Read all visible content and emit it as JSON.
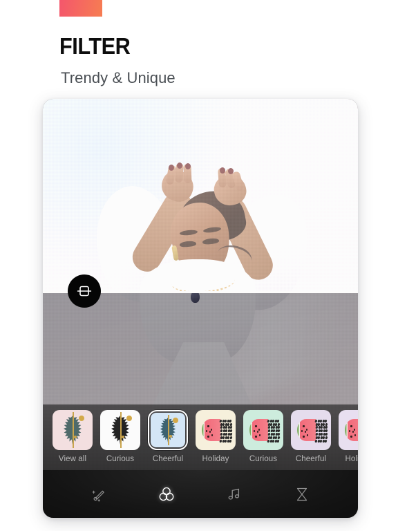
{
  "header": {
    "accent_swatch": "accent-gradient-swatch",
    "accent_from": "#f4566c",
    "accent_to": "#f67d52",
    "title": "FILTER",
    "subtitle": "Trendy & Unique"
  },
  "editor": {
    "compare_toggle_icon": "split-compare-icon",
    "preview_after_label": "filtered-preview",
    "preview_before_label": "original-preview"
  },
  "filters": {
    "items": [
      {
        "label": "View all",
        "art": "leaf",
        "bg": "#f3dfe0",
        "leaf": "#4f6a6a",
        "selected": false
      },
      {
        "label": "Curious",
        "art": "leaf",
        "bg": "#fbfbfb",
        "leaf": "#232323",
        "selected": false
      },
      {
        "label": "Cheerful",
        "art": "leaf",
        "bg": "#d4e6f6",
        "leaf": "#3d6270",
        "selected": true
      },
      {
        "label": "Holiday",
        "art": "melon",
        "bg": "#f6f0dc",
        "selected": false
      },
      {
        "label": "Curious",
        "art": "melon",
        "bg": "#cdecdd",
        "selected": false
      },
      {
        "label": "Cheerful",
        "art": "melon",
        "bg": "#e5dced",
        "selected": false
      },
      {
        "label": "Holiday",
        "art": "melon",
        "bg": "#e8dff0",
        "selected": false
      }
    ]
  },
  "toolbar": {
    "items": [
      {
        "icon": "magic-brush-icon",
        "active": false
      },
      {
        "icon": "filter-circles-icon",
        "active": true
      },
      {
        "icon": "music-note-icon",
        "active": false
      },
      {
        "icon": "hourglass-icon",
        "active": false
      }
    ]
  }
}
